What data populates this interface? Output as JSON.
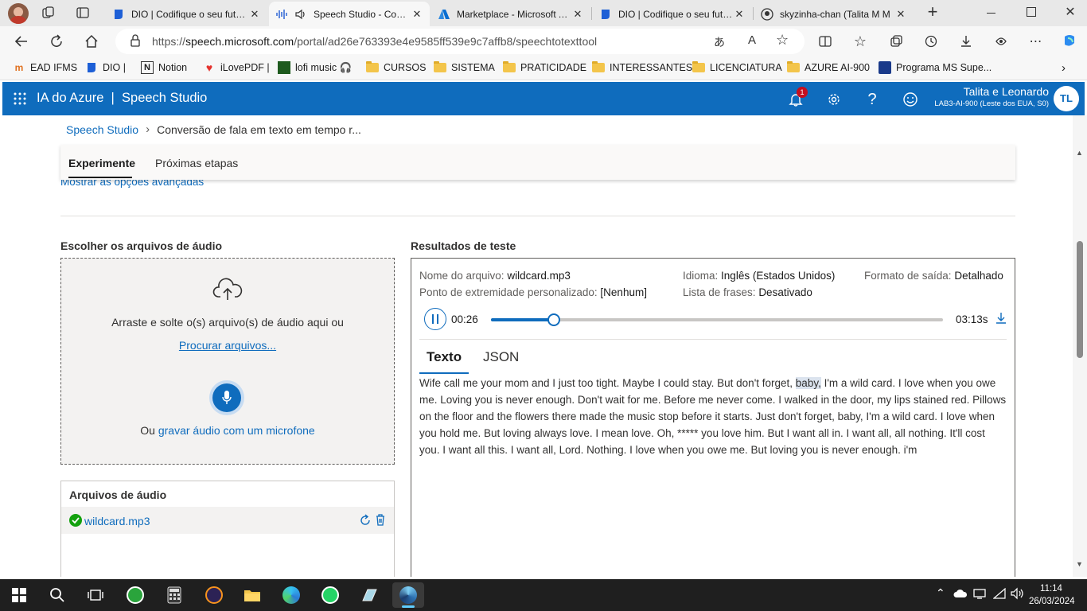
{
  "browser": {
    "tabs": [
      {
        "title": "DIO | Codifique o seu futuro",
        "active": false
      },
      {
        "title": "Speech Studio - Conversão",
        "active": true
      },
      {
        "title": "Marketplace - Microsoft Azure",
        "active": false
      },
      {
        "title": "DIO | Codifique o seu futuro",
        "active": false
      },
      {
        "title": "skyzinha-chan (Talita M M",
        "active": false
      }
    ],
    "url_prefix": "https://",
    "url_host": "speech.microsoft.com",
    "url_path": "/portal/ad26e763393e4e9585ff539e9c7affb8/speechtotexttool",
    "bookmarks": [
      "EAD IFMS",
      "DIO |",
      "Notion",
      "iLovePDF |",
      "lofi music 🎧",
      "CURSOS",
      "SISTEMA",
      "PRATICIDADE",
      "INTERESSANTES",
      "LICENCIATURA",
      "AZURE AI-900",
      "Programa MS Supe..."
    ]
  },
  "header": {
    "brand": "IA do Azure  |  Speech Studio",
    "notification_count": "1",
    "user_name": "Talita e Leonardo",
    "user_sub": "LAB3-AI-900 (Leste dos EUA, S0)",
    "avatar": "TL"
  },
  "breadcrumb": {
    "root": "Speech Studio",
    "current": "Conversão de fala em texto em tempo r..."
  },
  "tabs": {
    "experiment": "Experimente",
    "next_steps": "Próximas etapas"
  },
  "advanced_link": "Mostrar as opções avançadas",
  "upload": {
    "title": "Escolher os arquivos de áudio",
    "drag_text": "Arraste e solte o(s) arquivo(s) de áudio aqui ou",
    "browse_link": "Procurar arquivos...",
    "or_text": "Ou",
    "mic_link": "gravar áudio com um microfone"
  },
  "files": {
    "title": "Arquivos de áudio",
    "items": [
      "wildcard.mp3"
    ]
  },
  "results": {
    "title": "Resultados de teste",
    "filename_label": "Nome do arquivo:",
    "filename": "wildcard.mp3",
    "language_label": "Idioma:",
    "language": "Inglês (Estados Unidos)",
    "format_label": "Formato de saída:",
    "format": "Detalhado",
    "endpoint_label": "Ponto de extremidade personalizado:",
    "endpoint": "[Nenhum]",
    "phrase_label": "Lista de frases:",
    "phrase": "Desativado",
    "current_time": "00:26",
    "total_time": "03:13s",
    "progress": 0.139,
    "tab_text": "Texto",
    "tab_json": "JSON",
    "transcript_before": "Wife call me your mom and I just too tight. Maybe I could stay. But don't forget, ",
    "transcript_highlight": "baby,",
    "transcript_after": " I'm a wild card. I love when you owe me. Loving you is never enough. Don't wait for me. Before me never come. I walked in the door, my lips stained red. Pillows on the floor and the flowers there made the music stop before it starts. Just don't forget, baby, I'm a wild card. I love when you hold me. But loving always love. I mean love. Oh, ***** you love him. But I want all in. I want all, all nothing. It'll cost you. I want all this. I want all, Lord. Nothing. I love when you owe me. But loving you is never enough. i'm"
  },
  "taskbar": {
    "time": "11:14",
    "date": "26/03/2024"
  },
  "colors": {
    "azure_blue": "#0f6cbd",
    "success_green": "#13a10e",
    "badge_red": "#c50f1f"
  }
}
